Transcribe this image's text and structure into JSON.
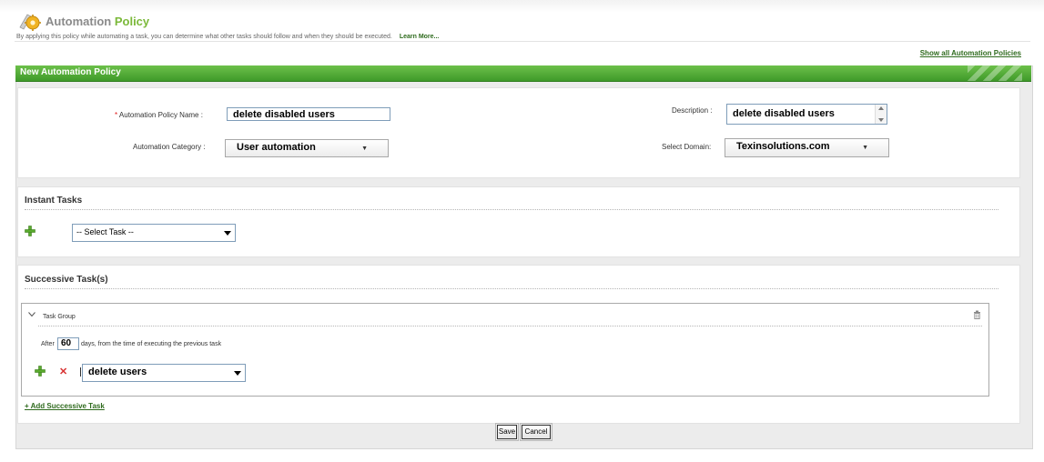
{
  "header": {
    "title_part1": "Automation",
    "title_part2": "Policy",
    "subtitle": "By applying this policy while automating a task, you can determine what other tasks should follow and when they should be executed.",
    "learn_more": "Learn More...",
    "show_all_link": "Show all Automation Policies"
  },
  "panel": {
    "title": "New Automation Policy"
  },
  "form": {
    "required_marker": "*",
    "policy_name_label": "Automation Policy Name :",
    "policy_name_value": "delete disabled users",
    "description_label": "Description :",
    "description_value": "delete disabled users",
    "category_label": "Automation Category :",
    "category_value": "User automation",
    "domain_label": "Select Domain:",
    "domain_value": "Texinsolutions.com"
  },
  "instant_tasks": {
    "title": "Instant Tasks",
    "select_value": "-- Select Task --"
  },
  "successive_tasks": {
    "title": "Successive Task(s)",
    "group_label": "Task Group",
    "after_label": "After",
    "days_value": "60",
    "days_suffix": "days, from the time of executing the previous task",
    "task_value": "delete users",
    "add_link": "+ Add Successive Task"
  },
  "buttons": {
    "save": "Save",
    "cancel": "Cancel"
  },
  "colors": {
    "accent_green": "#7bb93a",
    "header_green": "#4caf34",
    "link_green": "#2f6b1e",
    "remove_red": "#d83232"
  },
  "icons": [
    "gear-logo-icon",
    "plus-icon",
    "remove-icon",
    "collapse-chevron-icon",
    "trash-icon",
    "dropdown-caret-icon"
  ]
}
